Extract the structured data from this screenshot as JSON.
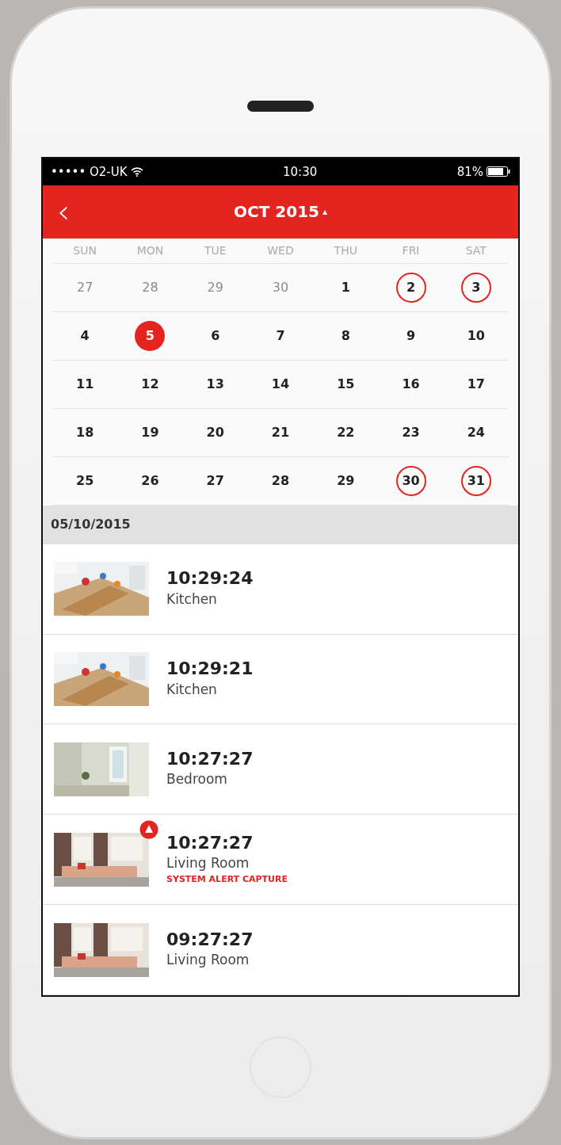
{
  "status_bar": {
    "carrier": "••••• O2-UK",
    "time": "10:30",
    "battery": "81%"
  },
  "header": {
    "back": "‹",
    "title": "OCT 2015",
    "caret": "▴"
  },
  "weekdays": [
    "SUN",
    "MON",
    "TUE",
    "WED",
    "THU",
    "FRI",
    "SAT"
  ],
  "weeks": [
    [
      {
        "day": "27",
        "muted": true,
        "event": false,
        "selected": false
      },
      {
        "day": "28",
        "muted": true,
        "event": false,
        "selected": false
      },
      {
        "day": "29",
        "muted": true,
        "event": false,
        "selected": false
      },
      {
        "day": "30",
        "muted": true,
        "event": false,
        "selected": false
      },
      {
        "day": "1",
        "muted": false,
        "event": false,
        "selected": false
      },
      {
        "day": "2",
        "muted": false,
        "event": true,
        "selected": false
      },
      {
        "day": "3",
        "muted": false,
        "event": true,
        "selected": false
      }
    ],
    [
      {
        "day": "4",
        "muted": false,
        "event": false,
        "selected": false
      },
      {
        "day": "5",
        "muted": false,
        "event": false,
        "selected": true
      },
      {
        "day": "6",
        "muted": false,
        "event": false,
        "selected": false
      },
      {
        "day": "7",
        "muted": false,
        "event": false,
        "selected": false
      },
      {
        "day": "8",
        "muted": false,
        "event": false,
        "selected": false
      },
      {
        "day": "9",
        "muted": false,
        "event": false,
        "selected": false
      },
      {
        "day": "10",
        "muted": false,
        "event": false,
        "selected": false
      }
    ],
    [
      {
        "day": "11",
        "muted": false,
        "event": false,
        "selected": false
      },
      {
        "day": "12",
        "muted": false,
        "event": false,
        "selected": false
      },
      {
        "day": "13",
        "muted": false,
        "event": false,
        "selected": false
      },
      {
        "day": "14",
        "muted": false,
        "event": false,
        "selected": false
      },
      {
        "day": "15",
        "muted": false,
        "event": false,
        "selected": false
      },
      {
        "day": "16",
        "muted": false,
        "event": false,
        "selected": false
      },
      {
        "day": "17",
        "muted": false,
        "event": false,
        "selected": false
      }
    ],
    [
      {
        "day": "18",
        "muted": false,
        "event": false,
        "selected": false
      },
      {
        "day": "19",
        "muted": false,
        "event": false,
        "selected": false
      },
      {
        "day": "20",
        "muted": false,
        "event": false,
        "selected": false
      },
      {
        "day": "21",
        "muted": false,
        "event": false,
        "selected": false
      },
      {
        "day": "22",
        "muted": false,
        "event": false,
        "selected": false
      },
      {
        "day": "23",
        "muted": false,
        "event": false,
        "selected": false
      },
      {
        "day": "24",
        "muted": false,
        "event": false,
        "selected": false
      }
    ],
    [
      {
        "day": "25",
        "muted": false,
        "event": false,
        "selected": false
      },
      {
        "day": "26",
        "muted": false,
        "event": false,
        "selected": false
      },
      {
        "day": "27",
        "muted": false,
        "event": false,
        "selected": false
      },
      {
        "day": "28",
        "muted": false,
        "event": false,
        "selected": false
      },
      {
        "day": "29",
        "muted": false,
        "event": false,
        "selected": false
      },
      {
        "day": "30",
        "muted": false,
        "event": true,
        "selected": false
      },
      {
        "day": "31",
        "muted": false,
        "event": true,
        "selected": false
      }
    ]
  ],
  "section_date": "05/10/2015",
  "captures": [
    {
      "time": "10:29:24",
      "room": "Kitchen",
      "alert": false
    },
    {
      "time": "10:29:21",
      "room": "Kitchen",
      "alert": false
    },
    {
      "time": "10:27:27",
      "room": "Bedroom",
      "alert": false
    },
    {
      "time": "10:27:27",
      "room": "Living Room",
      "alert": true,
      "note": "SYSTEM ALERT CAPTURE"
    },
    {
      "time": "09:27:27",
      "room": "Living Room",
      "alert": false
    }
  ]
}
